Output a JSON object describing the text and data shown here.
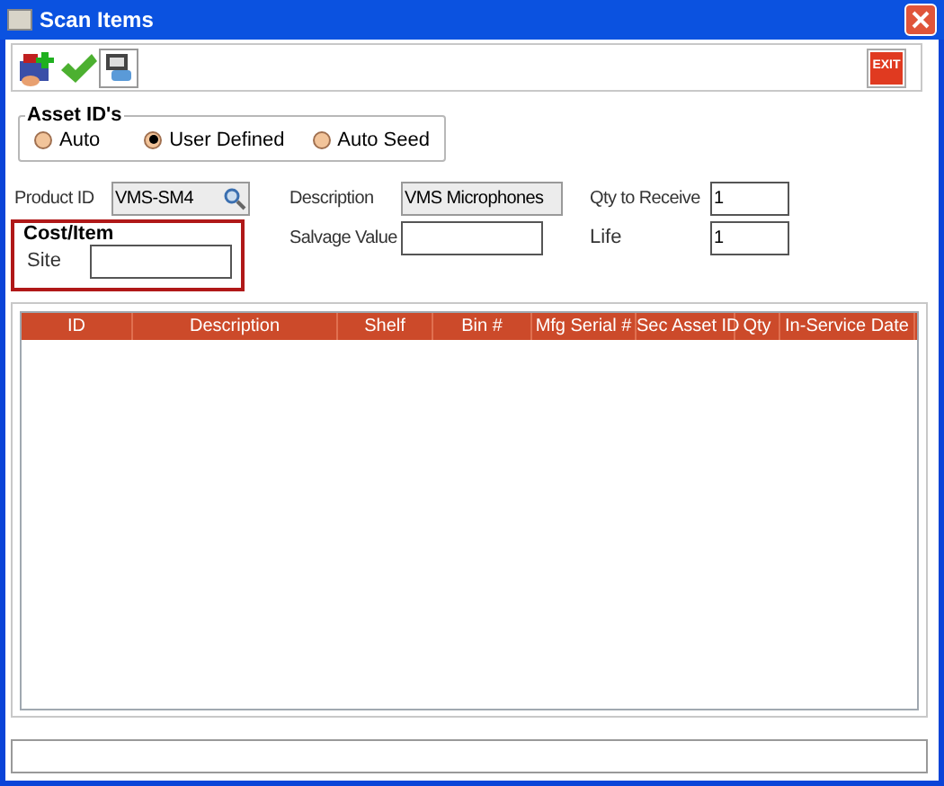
{
  "window": {
    "title": "Scan Items"
  },
  "toolbar": {
    "exit_label": "EXIT"
  },
  "asset_ids": {
    "title": "Asset ID's",
    "options": [
      {
        "label": "Auto",
        "selected": false
      },
      {
        "label": "User Defined",
        "selected": true
      },
      {
        "label": "Auto Seed",
        "selected": false
      }
    ]
  },
  "product_id": {
    "label": "Product ID",
    "value": "VMS-SM4"
  },
  "description": {
    "label": "Description",
    "value": "VMS Microphones"
  },
  "qty_to_receive": {
    "label": "Qty to Receive",
    "value": "1"
  },
  "cost_item": {
    "title": "Cost/Item",
    "site_label": "Site"
  },
  "salvage_value": {
    "label": "Salvage Value"
  },
  "life": {
    "label": "Life",
    "value": "1"
  },
  "table": {
    "columns": [
      "ID",
      "Description",
      "Shelf",
      "Bin #",
      "Mfg Serial #",
      "Sec Asset ID",
      "Qty",
      "In-Service Date"
    ]
  }
}
